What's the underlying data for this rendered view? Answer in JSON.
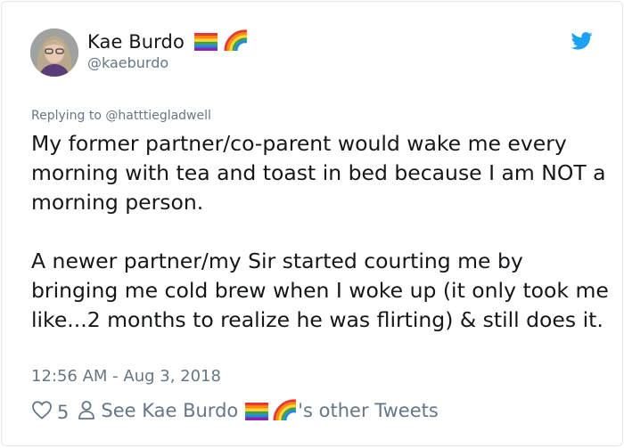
{
  "author": {
    "display_name": "Kae Burdo",
    "handle": "@kaeburdo",
    "name_emoji": [
      "rainbow-flag-icon",
      "rainbow-icon"
    ]
  },
  "reply": {
    "prefix": "Replying to",
    "to_handle": "@hatttiegladwell"
  },
  "tweet": {
    "text": "My former partner/co-parent would wake me every morning with tea and toast in bed because I am NOT a morning person.\n\nA newer partner/my Sir started courting me by bringing me cold brew when I woke up (it only took me like...2 months to realize he was flirting) & still does it.",
    "timestamp": "12:56 AM - Aug 3, 2018"
  },
  "actions": {
    "like_count": "5",
    "see_prefix": "See Kae Burdo",
    "see_suffix": "'s other Tweets"
  },
  "colors": {
    "text": "#14171a",
    "muted": "#657786",
    "twitter_blue": "#1da1f2",
    "border": "#e1e8ed"
  }
}
